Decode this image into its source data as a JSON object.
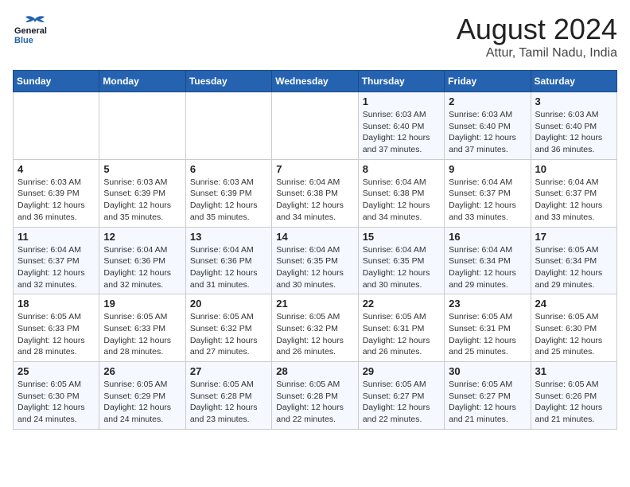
{
  "header": {
    "logo_general": "General",
    "logo_blue": "Blue",
    "title": "August 2024",
    "subtitle": "Attur, Tamil Nadu, India"
  },
  "weekdays": [
    "Sunday",
    "Monday",
    "Tuesday",
    "Wednesday",
    "Thursday",
    "Friday",
    "Saturday"
  ],
  "weeks": [
    [
      {
        "day": "",
        "sunrise": "",
        "sunset": "",
        "daylight": ""
      },
      {
        "day": "",
        "sunrise": "",
        "sunset": "",
        "daylight": ""
      },
      {
        "day": "",
        "sunrise": "",
        "sunset": "",
        "daylight": ""
      },
      {
        "day": "",
        "sunrise": "",
        "sunset": "",
        "daylight": ""
      },
      {
        "day": "1",
        "sunrise": "Sunrise: 6:03 AM",
        "sunset": "Sunset: 6:40 PM",
        "daylight": "Daylight: 12 hours and 37 minutes."
      },
      {
        "day": "2",
        "sunrise": "Sunrise: 6:03 AM",
        "sunset": "Sunset: 6:40 PM",
        "daylight": "Daylight: 12 hours and 37 minutes."
      },
      {
        "day": "3",
        "sunrise": "Sunrise: 6:03 AM",
        "sunset": "Sunset: 6:40 PM",
        "daylight": "Daylight: 12 hours and 36 minutes."
      }
    ],
    [
      {
        "day": "4",
        "sunrise": "Sunrise: 6:03 AM",
        "sunset": "Sunset: 6:39 PM",
        "daylight": "Daylight: 12 hours and 36 minutes."
      },
      {
        "day": "5",
        "sunrise": "Sunrise: 6:03 AM",
        "sunset": "Sunset: 6:39 PM",
        "daylight": "Daylight: 12 hours and 35 minutes."
      },
      {
        "day": "6",
        "sunrise": "Sunrise: 6:03 AM",
        "sunset": "Sunset: 6:39 PM",
        "daylight": "Daylight: 12 hours and 35 minutes."
      },
      {
        "day": "7",
        "sunrise": "Sunrise: 6:04 AM",
        "sunset": "Sunset: 6:38 PM",
        "daylight": "Daylight: 12 hours and 34 minutes."
      },
      {
        "day": "8",
        "sunrise": "Sunrise: 6:04 AM",
        "sunset": "Sunset: 6:38 PM",
        "daylight": "Daylight: 12 hours and 34 minutes."
      },
      {
        "day": "9",
        "sunrise": "Sunrise: 6:04 AM",
        "sunset": "Sunset: 6:37 PM",
        "daylight": "Daylight: 12 hours and 33 minutes."
      },
      {
        "day": "10",
        "sunrise": "Sunrise: 6:04 AM",
        "sunset": "Sunset: 6:37 PM",
        "daylight": "Daylight: 12 hours and 33 minutes."
      }
    ],
    [
      {
        "day": "11",
        "sunrise": "Sunrise: 6:04 AM",
        "sunset": "Sunset: 6:37 PM",
        "daylight": "Daylight: 12 hours and 32 minutes."
      },
      {
        "day": "12",
        "sunrise": "Sunrise: 6:04 AM",
        "sunset": "Sunset: 6:36 PM",
        "daylight": "Daylight: 12 hours and 32 minutes."
      },
      {
        "day": "13",
        "sunrise": "Sunrise: 6:04 AM",
        "sunset": "Sunset: 6:36 PM",
        "daylight": "Daylight: 12 hours and 31 minutes."
      },
      {
        "day": "14",
        "sunrise": "Sunrise: 6:04 AM",
        "sunset": "Sunset: 6:35 PM",
        "daylight": "Daylight: 12 hours and 30 minutes."
      },
      {
        "day": "15",
        "sunrise": "Sunrise: 6:04 AM",
        "sunset": "Sunset: 6:35 PM",
        "daylight": "Daylight: 12 hours and 30 minutes."
      },
      {
        "day": "16",
        "sunrise": "Sunrise: 6:04 AM",
        "sunset": "Sunset: 6:34 PM",
        "daylight": "Daylight: 12 hours and 29 minutes."
      },
      {
        "day": "17",
        "sunrise": "Sunrise: 6:05 AM",
        "sunset": "Sunset: 6:34 PM",
        "daylight": "Daylight: 12 hours and 29 minutes."
      }
    ],
    [
      {
        "day": "18",
        "sunrise": "Sunrise: 6:05 AM",
        "sunset": "Sunset: 6:33 PM",
        "daylight": "Daylight: 12 hours and 28 minutes."
      },
      {
        "day": "19",
        "sunrise": "Sunrise: 6:05 AM",
        "sunset": "Sunset: 6:33 PM",
        "daylight": "Daylight: 12 hours and 28 minutes."
      },
      {
        "day": "20",
        "sunrise": "Sunrise: 6:05 AM",
        "sunset": "Sunset: 6:32 PM",
        "daylight": "Daylight: 12 hours and 27 minutes."
      },
      {
        "day": "21",
        "sunrise": "Sunrise: 6:05 AM",
        "sunset": "Sunset: 6:32 PM",
        "daylight": "Daylight: 12 hours and 26 minutes."
      },
      {
        "day": "22",
        "sunrise": "Sunrise: 6:05 AM",
        "sunset": "Sunset: 6:31 PM",
        "daylight": "Daylight: 12 hours and 26 minutes."
      },
      {
        "day": "23",
        "sunrise": "Sunrise: 6:05 AM",
        "sunset": "Sunset: 6:31 PM",
        "daylight": "Daylight: 12 hours and 25 minutes."
      },
      {
        "day": "24",
        "sunrise": "Sunrise: 6:05 AM",
        "sunset": "Sunset: 6:30 PM",
        "daylight": "Daylight: 12 hours and 25 minutes."
      }
    ],
    [
      {
        "day": "25",
        "sunrise": "Sunrise: 6:05 AM",
        "sunset": "Sunset: 6:30 PM",
        "daylight": "Daylight: 12 hours and 24 minutes."
      },
      {
        "day": "26",
        "sunrise": "Sunrise: 6:05 AM",
        "sunset": "Sunset: 6:29 PM",
        "daylight": "Daylight: 12 hours and 24 minutes."
      },
      {
        "day": "27",
        "sunrise": "Sunrise: 6:05 AM",
        "sunset": "Sunset: 6:28 PM",
        "daylight": "Daylight: 12 hours and 23 minutes."
      },
      {
        "day": "28",
        "sunrise": "Sunrise: 6:05 AM",
        "sunset": "Sunset: 6:28 PM",
        "daylight": "Daylight: 12 hours and 22 minutes."
      },
      {
        "day": "29",
        "sunrise": "Sunrise: 6:05 AM",
        "sunset": "Sunset: 6:27 PM",
        "daylight": "Daylight: 12 hours and 22 minutes."
      },
      {
        "day": "30",
        "sunrise": "Sunrise: 6:05 AM",
        "sunset": "Sunset: 6:27 PM",
        "daylight": "Daylight: 12 hours and 21 minutes."
      },
      {
        "day": "31",
        "sunrise": "Sunrise: 6:05 AM",
        "sunset": "Sunset: 6:26 PM",
        "daylight": "Daylight: 12 hours and 21 minutes."
      }
    ]
  ]
}
